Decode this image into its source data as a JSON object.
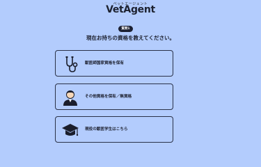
{
  "header": {
    "brand_sub": "ベットエージェント",
    "brand": "VetAgent"
  },
  "question": {
    "badge": "質問1",
    "text": "現在お持ちの資格を教えてください。"
  },
  "options": [
    {
      "label": "獣医師国家資格を保有",
      "icon": "stethoscope-icon"
    },
    {
      "label": "その他資格を保有／無資格",
      "icon": "person-icon"
    },
    {
      "label": "現役の獣医学生はこちら",
      "icon": "graduation-cap-icon"
    }
  ]
}
